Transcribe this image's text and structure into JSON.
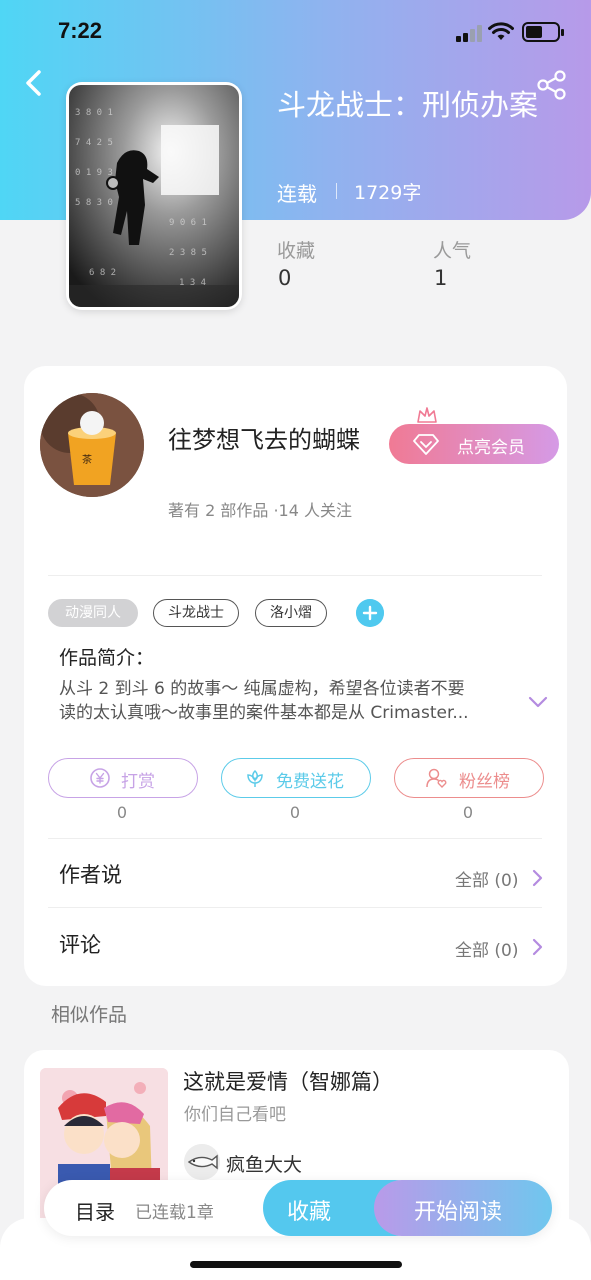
{
  "status_bar": {
    "time": "7:22",
    "battery_level": 0.5
  },
  "book": {
    "title": "斗龙战士：刑侦办案",
    "status": "连载",
    "word_count": "1729字",
    "stats": [
      {
        "label": "收藏",
        "value": "0"
      },
      {
        "label": "人气",
        "value": "1"
      }
    ]
  },
  "author": {
    "name": "往梦想飞去的蝴蝶",
    "member_button": "点亮会员",
    "meta": "著有 2 部作品 ·14 人关注"
  },
  "tags": [
    "动漫同人",
    "斗龙战士",
    "洛小熠"
  ],
  "intro": {
    "title": "作品简介：",
    "line1": "从斗 2 到斗 6 的故事～ 纯属虚构，希望各位读者不要",
    "line2": "读的太认真哦～故事里的案件基本都是从 Crimaster..."
  },
  "actions": [
    {
      "label": "打赏",
      "count": "0",
      "color": "#c7a3e6",
      "icon": "yuan-icon"
    },
    {
      "label": "免费送花",
      "count": "0",
      "color": "#5ccbe9",
      "icon": "flower-icon"
    },
    {
      "label": "粉丝榜",
      "count": "0",
      "color": "#ec8d8d",
      "icon": "fan-icon"
    }
  ],
  "rows": [
    {
      "title": "作者说",
      "right": "全部 (0)"
    },
    {
      "title": "评论",
      "right": "全部 (0)"
    }
  ],
  "similar": {
    "section_label": "相似作品",
    "title": "这就是爱情（智娜篇）",
    "subtitle": "你们自己看吧",
    "author": "疯鱼大大"
  },
  "bottom_bar": {
    "toc": "目录",
    "chapters": "已连载1章",
    "favorite": "收藏",
    "read": "开始阅读"
  },
  "colors": {
    "accent_cyan": "#4fd6f5",
    "accent_purple": "#b79ae9",
    "member_pink": "#f07a94",
    "chevron": "#b48be0"
  }
}
